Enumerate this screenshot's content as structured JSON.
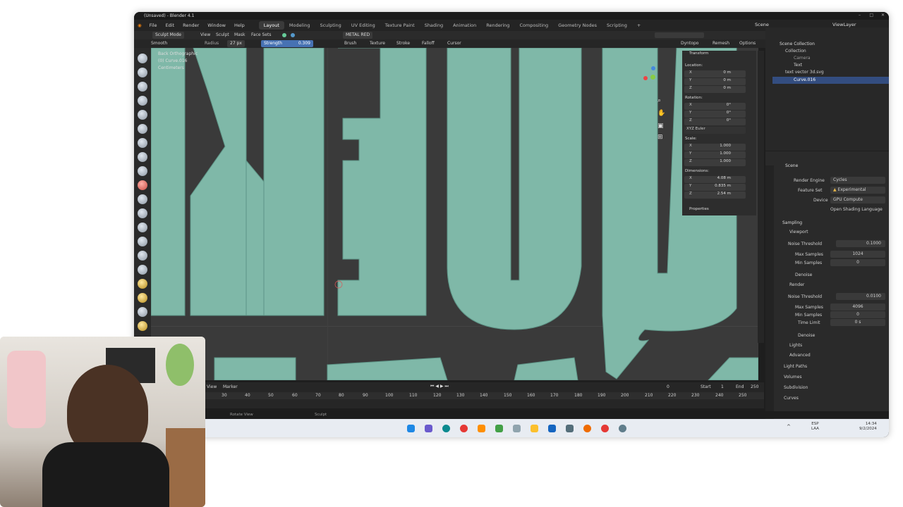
{
  "app": {
    "title": "(Unsaved) - Blender 4.1"
  },
  "menu": [
    "File",
    "Edit",
    "Render",
    "Window",
    "Help"
  ],
  "workspaces": [
    "Layout",
    "Modeling",
    "Sculpting",
    "UV Editing",
    "Texture Paint",
    "Shading",
    "Animation",
    "Rendering",
    "Compositing",
    "Geometry Nodes",
    "Scripting"
  ],
  "active_workspace": "Layout",
  "top_right": {
    "scene": "Scene",
    "viewlayer": "ViewLayer"
  },
  "header1": {
    "mode": "Sculpt Mode",
    "view": "View",
    "sculpt": "Sculpt",
    "mask": "Mask",
    "face_sets": "Face Sets",
    "material": "METAL RED"
  },
  "header2": {
    "brush": "Smooth",
    "radius_label": "Radius",
    "radius_value": "27 px",
    "strength_label": "Strength",
    "strength_value": "0.309",
    "brush_menu": "Brush",
    "texture": "Texture",
    "stroke": "Stroke",
    "falloff": "Falloff",
    "cursor": "Cursor",
    "dyntopo": "Dyntopo",
    "remesh": "Remesh",
    "options": "Options"
  },
  "viewport_info": {
    "line1": "Back Orthographic",
    "line2": "(0) Curve.016",
    "line3": "Centimeters"
  },
  "npanel": {
    "transform": "Transform",
    "location": "Location:",
    "loc": [
      {
        "axis": "X",
        "value": "0 m"
      },
      {
        "axis": "Y",
        "value": "0 m"
      },
      {
        "axis": "Z",
        "value": "0 m"
      }
    ],
    "rotation": "Rotation:",
    "rot": [
      {
        "axis": "X",
        "value": "0°"
      },
      {
        "axis": "Y",
        "value": "0°"
      },
      {
        "axis": "Z",
        "value": "0°"
      }
    ],
    "euler": "XYZ Euler",
    "scale": "Scale:",
    "scl": [
      {
        "axis": "X",
        "value": "1.000"
      },
      {
        "axis": "Y",
        "value": "1.000"
      },
      {
        "axis": "Z",
        "value": "1.000"
      }
    ],
    "dimensions": "Dimensions:",
    "dim": [
      {
        "axis": "X",
        "value": "4.08 m"
      },
      {
        "axis": "Y",
        "value": "0.835 m"
      },
      {
        "axis": "Z",
        "value": "2.54 m"
      }
    ],
    "properties": "Properties"
  },
  "outliner": {
    "scene_collection": "Scene Collection",
    "items": [
      "Collection",
      "Camera",
      "Text",
      "text vector 3d.svg",
      "Curve.016"
    ]
  },
  "props": {
    "scene": "Scene",
    "render_engine_label": "Render Engine",
    "render_engine": "Cycles",
    "feature_set_label": "Feature Set",
    "feature_set": "Experimental",
    "device_label": "Device",
    "device": "GPU Compute",
    "osl": "Open Shading Language",
    "sampling": "Sampling",
    "viewport": "Viewport",
    "noise_threshold": "Noise Threshold",
    "vp_noise": "0.1000",
    "max_samples": "Max Samples",
    "vp_max": "1024",
    "min_samples": "Min Samples",
    "vp_min": "0",
    "denoise": "Denoise",
    "render": "Render",
    "r_noise": "0.0100",
    "r_max": "4096",
    "r_min": "0",
    "time_limit": "Time Limit",
    "r_time": "0 s",
    "lights": "Lights",
    "advanced": "Advanced",
    "light_paths": "Light Paths",
    "volumes": "Volumes",
    "subdivision": "Subdivision",
    "curves": "Curves"
  },
  "timeline": {
    "view": "View",
    "marker": "Marker",
    "frame": "0",
    "start_label": "Start",
    "start": "1",
    "end_label": "End",
    "end": "250",
    "ticks": [
      "30",
      "40",
      "50",
      "60",
      "70",
      "80",
      "90",
      "100",
      "110",
      "120",
      "130",
      "140",
      "150",
      "160",
      "170",
      "180",
      "190",
      "200",
      "210",
      "220",
      "230",
      "240",
      "250"
    ]
  },
  "status": {
    "rotate": "Rotate View",
    "sculpt": "Sculpt"
  },
  "clock": {
    "time": "14:34",
    "date": "9/2/2024",
    "lang1": "ESP",
    "lang2": "LAA"
  }
}
